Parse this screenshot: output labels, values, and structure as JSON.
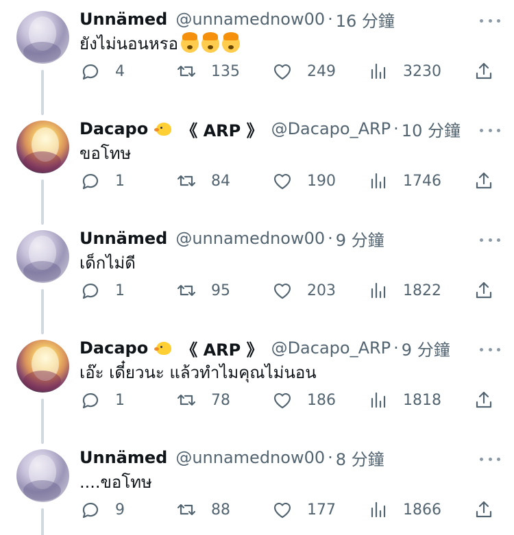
{
  "tweets": [
    {
      "name": "Unnämed",
      "badge": false,
      "name_suffix": "",
      "handle": "@unnamednow00",
      "time": "16 分鐘",
      "text": "ยังไม่นอนหรอ",
      "emoji_count": 3,
      "emoji": "exploding-head",
      "avatar": "unnamed",
      "replies": "4",
      "retweets": "135",
      "likes": "249",
      "views": "3230"
    },
    {
      "name": "Dacapo",
      "badge": true,
      "name_suffix": "《 ARP 》",
      "handle": "@Dacapo_ARP",
      "time": "10 分鐘",
      "text": "ขอโทษ",
      "emoji_count": 0,
      "avatar": "dacapo",
      "replies": "1",
      "retweets": "84",
      "likes": "190",
      "views": "1746"
    },
    {
      "name": "Unnämed",
      "badge": false,
      "name_suffix": "",
      "handle": "@unnamednow00",
      "time": "9 分鐘",
      "text": "เด็กไม่ดี",
      "emoji_count": 0,
      "avatar": "unnamed",
      "replies": "1",
      "retweets": "95",
      "likes": "203",
      "views": "1822"
    },
    {
      "name": "Dacapo",
      "badge": true,
      "name_suffix": "《 ARP 》",
      "handle": "@Dacapo_ARP",
      "time": "9 分鐘",
      "text": "เอ๊ะ เดี๋ยวนะ แล้วทำไมคุณไม่นอน",
      "emoji_count": 0,
      "avatar": "dacapo",
      "replies": "1",
      "retweets": "78",
      "likes": "186",
      "views": "1818"
    },
    {
      "name": "Unnämed",
      "badge": false,
      "name_suffix": "",
      "handle": "@unnamednow00",
      "time": "8 分鐘",
      "text": "....ขอโทษ",
      "emoji_count": 0,
      "avatar": "unnamed",
      "replies": "9",
      "retweets": "88",
      "likes": "177",
      "views": "1866"
    }
  ],
  "separator": "·",
  "colors": {
    "text": "#0f1419",
    "secondary": "#536471",
    "thread_line": "#cfd9de"
  }
}
